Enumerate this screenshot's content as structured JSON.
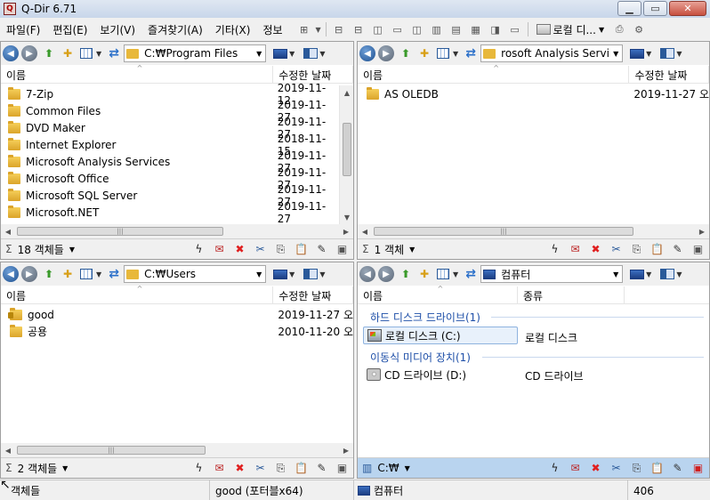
{
  "window": {
    "title": "Q-Dir 6.71",
    "app_icon": "Q",
    "minimize": "▁",
    "maximize": "▭",
    "close": "✕"
  },
  "menu": {
    "items": [
      "파일(F)",
      "편집(E)",
      "보기(V)",
      "즐겨찾기(A)",
      "기타(X)",
      "정보"
    ],
    "drive_label": "로컬 디..."
  },
  "pane_top_left": {
    "address": "C:₩Program Files",
    "columns": [
      "이름",
      "수정한 날짜"
    ],
    "rows": [
      {
        "name": "7-Zip",
        "date": "2019-11-12"
      },
      {
        "name": "Common Files",
        "date": "2019-11-27"
      },
      {
        "name": "DVD Maker",
        "date": "2019-11-27"
      },
      {
        "name": "Internet Explorer",
        "date": "2018-11-15"
      },
      {
        "name": "Microsoft Analysis Services",
        "date": "2019-11-27"
      },
      {
        "name": "Microsoft Office",
        "date": "2019-11-27"
      },
      {
        "name": "Microsoft SQL Server",
        "date": "2019-11-27"
      },
      {
        "name": "Microsoft.NET",
        "date": "2019-11-27"
      }
    ],
    "status": "18 객체들"
  },
  "pane_top_right": {
    "address": "rosoft Analysis Services",
    "columns": [
      "이름",
      "수정한 날짜"
    ],
    "rows": [
      {
        "name": "AS OLEDB",
        "date": "2019-11-27 오"
      }
    ],
    "status": "1 객체"
  },
  "pane_bottom_left": {
    "address": "C:₩Users",
    "columns": [
      "이름",
      "수정한 날짜"
    ],
    "rows": [
      {
        "name": "good",
        "date": "2019-11-27 오"
      },
      {
        "name": "공용",
        "date": "2010-11-20 오"
      }
    ],
    "status": "2 객체들"
  },
  "pane_bottom_right": {
    "address": "컴퓨터",
    "columns": [
      "이름",
      "종류"
    ],
    "groups": [
      {
        "label": "하드 디스크 드라이브(1)",
        "items": [
          {
            "name": "로컬 디스크 (C:)",
            "type": "로컬 디스크"
          }
        ]
      },
      {
        "label": "이동식 미디어 장치(1)",
        "items": [
          {
            "name": "CD 드라이브 (D:)",
            "type": "CD 드라이브"
          }
        ]
      }
    ],
    "status": "C:₩"
  },
  "bottom_status": {
    "objects": "객체들",
    "user": "good (포터블x64)",
    "location": "컴퓨터",
    "number": "406"
  },
  "glyphs": {
    "back": "◀",
    "forward": "▶",
    "up": "⬆",
    "new_folder": "✚",
    "refresh": "⇄",
    "dropdown": "▼",
    "sigma": "Σ",
    "bolt": "ϟ",
    "mail": "✉",
    "delete": "✖",
    "cut": "✂",
    "copy": "⎘",
    "paste": "📋",
    "edit": "✎",
    "props": "▣",
    "scroll_left": "◀",
    "scroll_right": "▶",
    "scroll_up": "▲",
    "scroll_down": "▼",
    "grip": "|||",
    "sort_caret": "^"
  }
}
